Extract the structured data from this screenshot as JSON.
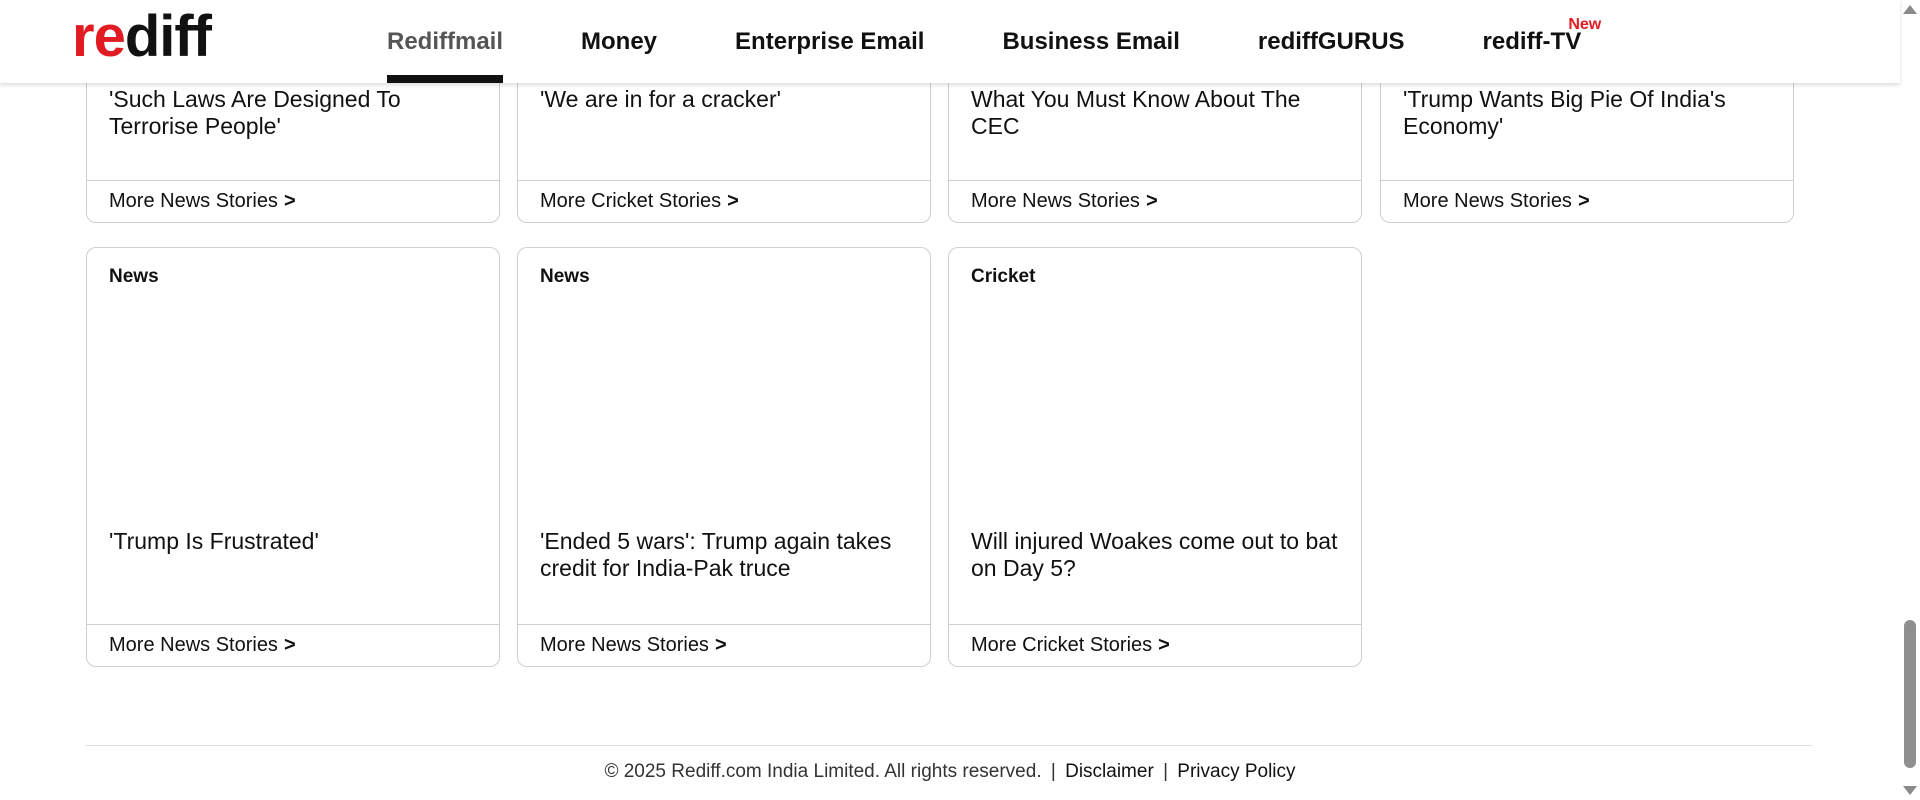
{
  "header": {
    "logo": {
      "part1": "re",
      "part2": "diff"
    },
    "nav": [
      {
        "label": "Rediffmail",
        "active": true
      },
      {
        "label": "Money"
      },
      {
        "label": "Enterprise Email"
      },
      {
        "label": "Business Email"
      },
      {
        "label": "rediffGURUS"
      },
      {
        "label": "rediff-TV",
        "badge": "New"
      }
    ]
  },
  "cards_row1": [
    {
      "headline": "'Such Laws Are Designed To Terrorise People'",
      "link": "More News Stories",
      "arrow": ">"
    },
    {
      "headline": "'We are in for a cracker'",
      "link": "More Cricket Stories",
      "arrow": ">"
    },
    {
      "headline": "What You Must Know About The CEC",
      "link": "More News Stories",
      "arrow": ">"
    },
    {
      "headline": "'Trump Wants Big Pie Of India's Economy'",
      "link": "More News Stories",
      "arrow": ">"
    }
  ],
  "cards_row2": [
    {
      "category": "News",
      "headline": "'Trump Is Frustrated'",
      "link": "More News Stories",
      "arrow": ">"
    },
    {
      "category": "News",
      "headline": "'Ended 5 wars': Trump again takes credit for India-Pak truce",
      "link": "More News Stories",
      "arrow": ">"
    },
    {
      "category": "Cricket",
      "headline": "Will injured Woakes come out to bat on Day 5?",
      "link": "More Cricket Stories",
      "arrow": ">"
    }
  ],
  "footer": {
    "copyright": "© 2025 Rediff.com India Limited. All rights reserved.",
    "separator": "|",
    "disclaimer": "Disclaimer",
    "privacy": "Privacy Policy"
  },
  "colors": {
    "brand_red": "#e11b22",
    "text": "#111111",
    "border": "#cfcfcf"
  }
}
